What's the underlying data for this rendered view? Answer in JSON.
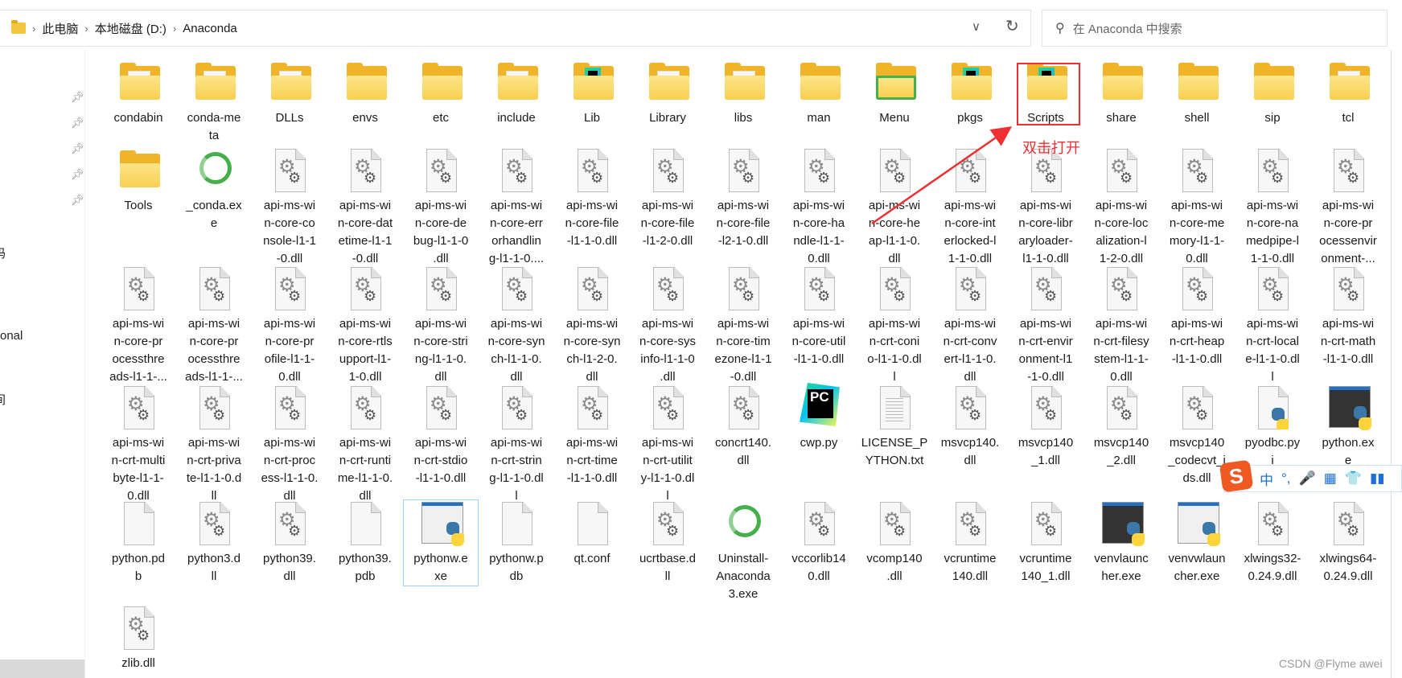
{
  "address_bar": {
    "breadcrumbs": [
      "此电脑",
      "本地磁盘 (D:)",
      "Anaconda"
    ],
    "dropdown_icon": "chevron-down-icon",
    "refresh_icon": "refresh-icon"
  },
  "search": {
    "placeholder": "在 Anaconda 中搜索",
    "icon": "search-icon"
  },
  "nav_pane": {
    "pin_count": 5,
    "partial_labels": [
      "码",
      "onal",
      "间"
    ]
  },
  "annotation": {
    "text": "双击打开",
    "target": "Scripts",
    "color": "#ee3033"
  },
  "ime_toolbar": {
    "logo": "S",
    "items": [
      "中",
      "°,",
      "🎤",
      "▦",
      "👕",
      "▮▮"
    ]
  },
  "watermark": "CSDN @Flyme awei",
  "selected_item": "pythonw.exe",
  "rows": [
    [
      {
        "label": "condabin",
        "icon": "folder-doc"
      },
      {
        "label": "conda-me\nta",
        "icon": "folder-doc"
      },
      {
        "label": "DLLs",
        "icon": "folder-doc"
      },
      {
        "label": "envs",
        "icon": "folder"
      },
      {
        "label": "etc",
        "icon": "folder"
      },
      {
        "label": "include",
        "icon": "folder-doc"
      },
      {
        "label": "Lib",
        "icon": "folder-pc"
      },
      {
        "label": "Library",
        "icon": "folder-doc"
      },
      {
        "label": "libs",
        "icon": "folder-doc"
      },
      {
        "label": "man",
        "icon": "folder"
      },
      {
        "label": "Menu",
        "icon": "folder-conda"
      },
      {
        "label": "pkgs",
        "icon": "folder-pc"
      },
      {
        "label": "Scripts",
        "icon": "folder-pc"
      },
      {
        "label": "share",
        "icon": "folder"
      },
      {
        "label": "shell",
        "icon": "folder"
      },
      {
        "label": "sip",
        "icon": "folder"
      },
      {
        "label": "tcl",
        "icon": "folder-doc"
      }
    ],
    [
      {
        "label": "Tools",
        "icon": "folder"
      },
      {
        "label": "_conda.ex\ne",
        "icon": "conda"
      },
      {
        "label": "api-ms-wi\nn-core-co\nnsole-l1-1\n-0.dll",
        "icon": "dll"
      },
      {
        "label": "api-ms-wi\nn-core-dat\netime-l1-1\n-0.dll",
        "icon": "dll"
      },
      {
        "label": "api-ms-wi\nn-core-de\nbug-l1-1-0\n.dll",
        "icon": "dll"
      },
      {
        "label": "api-ms-wi\nn-core-err\norhandlin\ng-l1-1-0....",
        "icon": "dll"
      },
      {
        "label": "api-ms-wi\nn-core-file\n-l1-1-0.dll",
        "icon": "dll"
      },
      {
        "label": "api-ms-wi\nn-core-file\n-l1-2-0.dll",
        "icon": "dll"
      },
      {
        "label": "api-ms-wi\nn-core-file\n-l2-1-0.dll",
        "icon": "dll"
      },
      {
        "label": "api-ms-wi\nn-core-ha\nndle-l1-1-\n0.dll",
        "icon": "dll"
      },
      {
        "label": "api-ms-wi\nn-core-he\nap-l1-1-0.\ndll",
        "icon": "dll"
      },
      {
        "label": "api-ms-wi\nn-core-int\nerlocked-l\n1-1-0.dll",
        "icon": "dll"
      },
      {
        "label": "api-ms-wi\nn-core-libr\naryloader-\nl1-1-0.dll",
        "icon": "dll"
      },
      {
        "label": "api-ms-wi\nn-core-loc\nalization-l\n1-2-0.dll",
        "icon": "dll"
      },
      {
        "label": "api-ms-wi\nn-core-me\nmory-l1-1-\n0.dll",
        "icon": "dll"
      },
      {
        "label": "api-ms-wi\nn-core-na\nmedpipe-l\n1-1-0.dll",
        "icon": "dll"
      },
      {
        "label": "api-ms-wi\nn-core-pr\nocessenvir\nonment-...",
        "icon": "dll"
      }
    ],
    [
      {
        "label": "api-ms-wi\nn-core-pr\nocessthre\nads-l1-1-...",
        "icon": "dll"
      },
      {
        "label": "api-ms-wi\nn-core-pr\nocessthre\nads-l1-1-...",
        "icon": "dll"
      },
      {
        "label": "api-ms-wi\nn-core-pr\nofile-l1-1-\n0.dll",
        "icon": "dll"
      },
      {
        "label": "api-ms-wi\nn-core-rtls\nupport-l1-\n1-0.dll",
        "icon": "dll"
      },
      {
        "label": "api-ms-wi\nn-core-stri\nng-l1-1-0.\ndll",
        "icon": "dll"
      },
      {
        "label": "api-ms-wi\nn-core-syn\nch-l1-1-0.\ndll",
        "icon": "dll"
      },
      {
        "label": "api-ms-wi\nn-core-syn\nch-l1-2-0.\ndll",
        "icon": "dll"
      },
      {
        "label": "api-ms-wi\nn-core-sys\ninfo-l1-1-0\n.dll",
        "icon": "dll"
      },
      {
        "label": "api-ms-wi\nn-core-tim\nezone-l1-1\n-0.dll",
        "icon": "dll"
      },
      {
        "label": "api-ms-wi\nn-core-util\n-l1-1-0.dll",
        "icon": "dll"
      },
      {
        "label": "api-ms-wi\nn-crt-coni\no-l1-1-0.dl\nl",
        "icon": "dll"
      },
      {
        "label": "api-ms-wi\nn-crt-conv\nert-l1-1-0.\ndll",
        "icon": "dll"
      },
      {
        "label": "api-ms-wi\nn-crt-envir\nonment-l1\n-1-0.dll",
        "icon": "dll"
      },
      {
        "label": "api-ms-wi\nn-crt-filesy\nstem-l1-1-\n0.dll",
        "icon": "dll"
      },
      {
        "label": "api-ms-wi\nn-crt-heap\n-l1-1-0.dll",
        "icon": "dll"
      },
      {
        "label": "api-ms-wi\nn-crt-local\ne-l1-1-0.dl\nl",
        "icon": "dll"
      },
      {
        "label": "api-ms-wi\nn-crt-math\n-l1-1-0.dll",
        "icon": "dll"
      }
    ],
    [
      {
        "label": "api-ms-wi\nn-crt-multi\nbyte-l1-1-\n0.dll",
        "icon": "dll"
      },
      {
        "label": "api-ms-wi\nn-crt-priva\nte-l1-1-0.d\nll",
        "icon": "dll"
      },
      {
        "label": "api-ms-wi\nn-crt-proc\ness-l1-1-0.\ndll",
        "icon": "dll"
      },
      {
        "label": "api-ms-wi\nn-crt-runti\nme-l1-1-0.\ndll",
        "icon": "dll"
      },
      {
        "label": "api-ms-wi\nn-crt-stdio\n-l1-1-0.dll",
        "icon": "dll"
      },
      {
        "label": "api-ms-wi\nn-crt-strin\ng-l1-1-0.dl\nl",
        "icon": "dll"
      },
      {
        "label": "api-ms-wi\nn-crt-time\n-l1-1-0.dll",
        "icon": "dll"
      },
      {
        "label": "api-ms-wi\nn-crt-utilit\ny-l1-1-0.dl\nl",
        "icon": "dll"
      },
      {
        "label": "concrt140.\ndll",
        "icon": "dll"
      },
      {
        "label": "cwp.py",
        "icon": "pycharm"
      },
      {
        "label": "LICENSE_P\nYTHON.txt",
        "icon": "txt"
      },
      {
        "label": "msvcp140.\ndll",
        "icon": "dll"
      },
      {
        "label": "msvcp140\n_1.dll",
        "icon": "dll"
      },
      {
        "label": "msvcp140\n_2.dll",
        "icon": "dll"
      },
      {
        "label": "msvcp140\n_codecvt_i\nds.dll",
        "icon": "dll"
      },
      {
        "label": "pyodbc.py\ni",
        "icon": "pyi"
      },
      {
        "label": "python.ex\ne",
        "icon": "pyexe-dark"
      }
    ],
    [
      {
        "label": "python.pd\nb",
        "icon": "blank"
      },
      {
        "label": "python3.d\nll",
        "icon": "dll"
      },
      {
        "label": "python39.\ndll",
        "icon": "dll"
      },
      {
        "label": "python39.\npdb",
        "icon": "blank"
      },
      {
        "label": "pythonw.e\nxe",
        "icon": "pyexe-light"
      },
      {
        "label": "pythonw.p\ndb",
        "icon": "blank"
      },
      {
        "label": "qt.conf",
        "icon": "blank"
      },
      {
        "label": "ucrtbase.d\nll",
        "icon": "dll"
      },
      {
        "label": "Uninstall-\nAnaconda\n3.exe",
        "icon": "conda"
      },
      {
        "label": "vccorlib14\n0.dll",
        "icon": "dll"
      },
      {
        "label": "vcomp140\n.dll",
        "icon": "dll"
      },
      {
        "label": "vcruntime\n140.dll",
        "icon": "dll"
      },
      {
        "label": "vcruntime\n140_1.dll",
        "icon": "dll"
      },
      {
        "label": "venvlaunc\nher.exe",
        "icon": "pyexe-dark"
      },
      {
        "label": "venvwlaun\ncher.exe",
        "icon": "pyexe-light"
      },
      {
        "label": "xlwings32-\n0.24.9.dll",
        "icon": "dll"
      },
      {
        "label": "xlwings64-\n0.24.9.dll",
        "icon": "dll"
      }
    ],
    [
      {
        "label": "zlib.dll",
        "icon": "dll"
      }
    ]
  ]
}
